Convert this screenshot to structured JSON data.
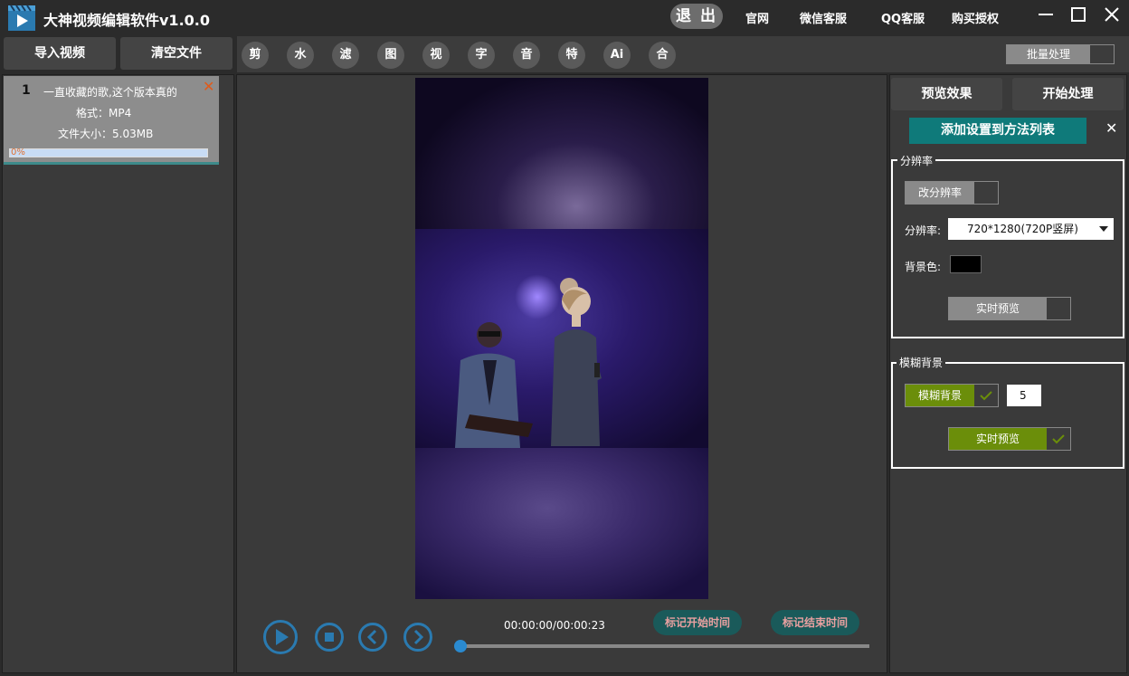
{
  "app": {
    "title": "大神视频编辑软件v1.0.0"
  },
  "header": {
    "exit_label": "退 出",
    "links": [
      "官网",
      "微信客服",
      "QQ客服",
      "购买授权"
    ]
  },
  "toolbar": {
    "import_label": "导入视频",
    "clear_label": "清空文件",
    "tools": [
      "剪",
      "水",
      "滤",
      "图",
      "视",
      "字",
      "音",
      "特",
      "Ai",
      "合"
    ],
    "batch_label": "批量处理"
  },
  "file_list": {
    "items": [
      {
        "index": "1",
        "name": "一直收藏的歌,这个版本真的",
        "format": "格式：MP4",
        "size": "文件大小：5.03MB",
        "progress_text": "0%",
        "progress": 0
      }
    ]
  },
  "player": {
    "time": "00:00:00/00:00:23",
    "mark_start_label": "标记开始时间",
    "mark_end_label": "标记结束时间",
    "seek_position": 0
  },
  "right_panel": {
    "preview_label": "预览效果",
    "start_label": "开始处理",
    "add_settings_label": "添加设置到方法列表",
    "resolution_group": {
      "title": "分辨率",
      "change_res_label": "改分辨率",
      "change_res_checked": false,
      "res_label": "分辨率:",
      "res_value": "720*1280(720P竖屏)",
      "bg_label": "背景色:",
      "bg_color": "#000000",
      "preview_label": "实时预览",
      "preview_checked": false
    },
    "blur_group": {
      "title": "模糊背景",
      "blur_bg_label": "模糊背景",
      "blur_bg_checked": true,
      "blur_value": "5",
      "preview_label": "实时预览",
      "preview_checked": true
    }
  },
  "colors": {
    "accent_teal": "#0f7a7a",
    "mark_button": "#1a5a5a",
    "checked_green": "#6b8e0a",
    "player_blue": "#2a7ab0",
    "close_orange": "#e05a1a"
  }
}
